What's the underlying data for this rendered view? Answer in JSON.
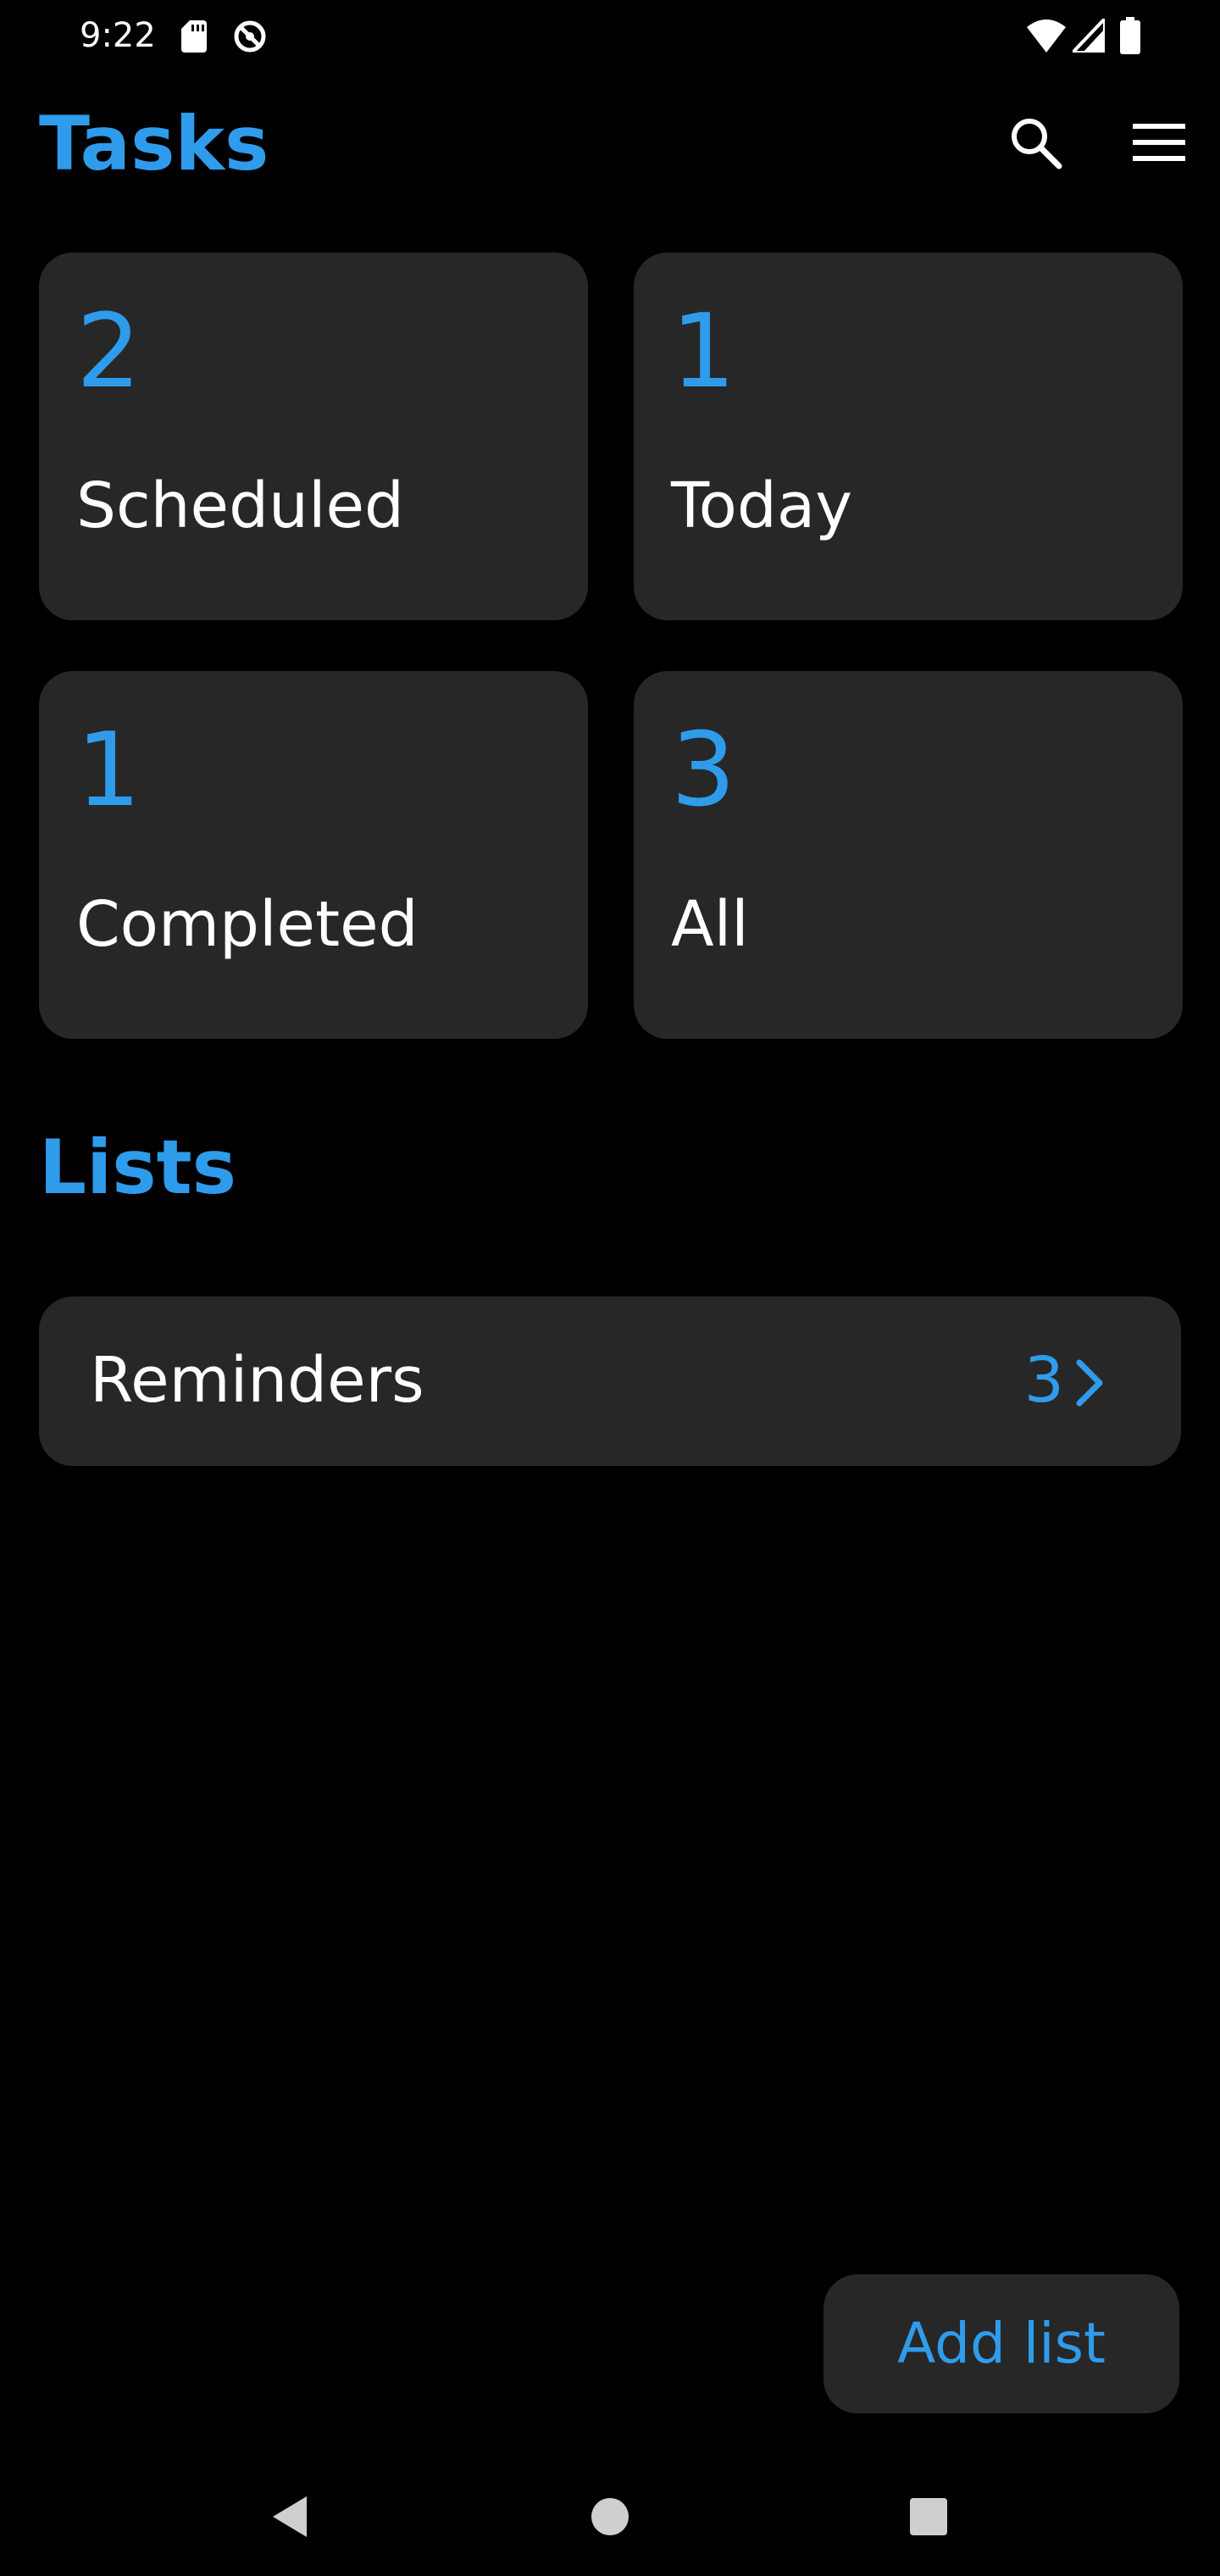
{
  "colors": {
    "accent": "#2f9ceb",
    "card": "#272727",
    "background": "#000000"
  },
  "status_bar": {
    "time": "9:22",
    "icons": [
      "sd-card-icon",
      "data-saver-icon",
      "wifi-icon",
      "cellular-signal-icon",
      "battery-icon"
    ]
  },
  "app_bar": {
    "title": "Tasks",
    "actions": [
      "search-icon",
      "menu-icon"
    ]
  },
  "summary_cards": [
    {
      "count": "2",
      "label": "Scheduled"
    },
    {
      "count": "1",
      "label": "Today"
    },
    {
      "count": "1",
      "label": "Completed"
    },
    {
      "count": "3",
      "label": "All"
    }
  ],
  "lists_section": {
    "title": "Lists",
    "items": [
      {
        "name": "Reminders",
        "count": "3",
        "icon": "chevron-right-icon"
      }
    ]
  },
  "add_list": {
    "label": "Add list"
  },
  "nav_bar": {
    "buttons": [
      "back-icon",
      "home-icon",
      "recents-icon"
    ]
  }
}
